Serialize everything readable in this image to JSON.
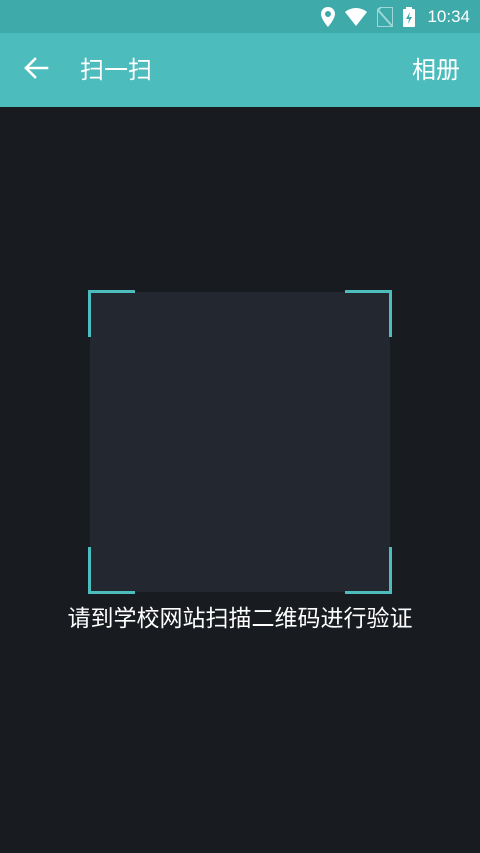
{
  "status_bar": {
    "time": "10:34",
    "icons": [
      "location-icon",
      "wifi-icon",
      "no-sim-icon",
      "battery-charging-icon"
    ]
  },
  "app_bar": {
    "back_icon": "arrow-left-icon",
    "title": "扫一扫",
    "album_label": "相册"
  },
  "scanner": {
    "hint": "请到学校网站扫描二维码进行验证"
  },
  "colors": {
    "status_bar": "#3eaaaa",
    "app_bar": "#4dbcbc",
    "background": "#181b20",
    "scan_area": "#232830",
    "accent": "#4dbcbc"
  }
}
